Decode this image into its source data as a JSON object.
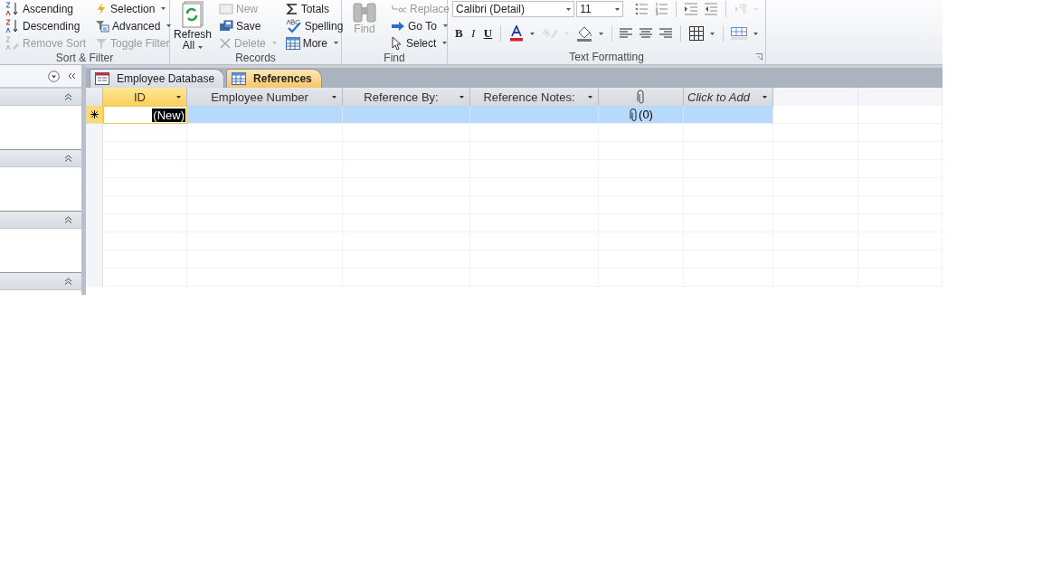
{
  "ribbon": {
    "groups": [
      {
        "label": "Sort & Filter",
        "columns": [
          [
            {
              "kind": "small",
              "label": "Ascending",
              "dropdown": false,
              "disabled": false
            },
            {
              "kind": "small",
              "label": "Descending",
              "dropdown": false,
              "disabled": false
            },
            {
              "kind": "small",
              "label": "Remove Sort",
              "dropdown": false,
              "disabled": true
            }
          ],
          [
            {
              "kind": "small",
              "label": "Selection",
              "dropdown": true,
              "disabled": false
            },
            {
              "kind": "small",
              "label": "Advanced",
              "dropdown": true,
              "disabled": false
            },
            {
              "kind": "small",
              "label": "Toggle Filter",
              "dropdown": false,
              "disabled": true
            }
          ]
        ]
      },
      {
        "label": "Records",
        "columns": [
          [
            {
              "kind": "large",
              "label": "Refresh All",
              "dropdown": true,
              "disabled": false
            }
          ],
          [
            {
              "kind": "small",
              "label": "New",
              "dropdown": false,
              "disabled": true
            },
            {
              "kind": "small",
              "label": "Save",
              "dropdown": false,
              "disabled": false
            },
            {
              "kind": "small",
              "label": "Delete",
              "dropdown": true,
              "disabled": true
            }
          ],
          [
            {
              "kind": "small",
              "label": "Totals",
              "dropdown": false,
              "disabled": false
            },
            {
              "kind": "small",
              "label": "Spelling",
              "dropdown": false,
              "disabled": false
            },
            {
              "kind": "small",
              "label": "More",
              "dropdown": true,
              "disabled": false
            }
          ]
        ]
      },
      {
        "label": "Find",
        "columns": [
          [
            {
              "kind": "large",
              "label": "Find",
              "dropdown": false,
              "disabled": true
            }
          ],
          [
            {
              "kind": "small",
              "label": "Replace",
              "dropdown": false,
              "disabled": true
            },
            {
              "kind": "small",
              "label": "Go To",
              "dropdown": true,
              "disabled": false
            },
            {
              "kind": "small",
              "label": "Select",
              "dropdown": true,
              "disabled": false
            }
          ]
        ]
      },
      {
        "label": "Text Formatting",
        "font": "Calibri (Detail)",
        "size": "11",
        "top_tools": [
          {
            "kind": "icon",
            "dropdown": false,
            "disabled": false
          },
          {
            "kind": "icon",
            "dropdown": false,
            "disabled": false
          },
          {
            "kind": "icon",
            "dropdown": false,
            "disabled": false
          },
          {
            "kind": "icon",
            "dropdown": false,
            "disabled": false
          },
          {
            "kind": "icon",
            "dropdown": true,
            "disabled": true
          }
        ],
        "bottom_tools": [
          {
            "kind": "letter",
            "label": "B"
          },
          {
            "kind": "letter",
            "label": "I"
          },
          {
            "kind": "letter",
            "label": "U"
          },
          {
            "kind": "icon",
            "dropdown": true,
            "disabled": false
          },
          {
            "kind": "icon",
            "dropdown": true,
            "disabled": true
          },
          {
            "kind": "icon",
            "dropdown": true,
            "disabled": false
          },
          {
            "kind": "icon",
            "dropdown": false,
            "disabled": false
          },
          {
            "kind": "icon",
            "dropdown": false,
            "disabled": false
          },
          {
            "kind": "icon",
            "dropdown": false,
            "disabled": false
          },
          {
            "kind": "icon",
            "dropdown": true,
            "disabled": false
          },
          {
            "kind": "icon",
            "dropdown": true,
            "disabled": false
          }
        ]
      }
    ]
  },
  "nav_pane": {
    "sections": [
      {
        "expanded": true
      },
      {
        "expanded": true
      },
      {
        "expanded": true
      },
      {
        "expanded": true
      }
    ]
  },
  "tabs": [
    {
      "label": "Employee Database",
      "kind": "form",
      "selected": false
    },
    {
      "label": "References",
      "kind": "table",
      "selected": true
    }
  ],
  "table": {
    "columns": [
      {
        "kind": "field",
        "label": "ID",
        "selected": true
      },
      {
        "kind": "field",
        "label": "Employee Number",
        "selected": false
      },
      {
        "kind": "field",
        "label": "Reference By:",
        "selected": false
      },
      {
        "kind": "field",
        "label": "Reference Notes:",
        "selected": false
      },
      {
        "kind": "attachment",
        "selected": false
      },
      {
        "kind": "add",
        "label": "Click to Add",
        "selected": false
      }
    ],
    "rows": [
      {
        "new_record": true,
        "selected": true,
        "cells": [
          "(New)",
          null,
          null,
          null,
          "(0)",
          null
        ]
      }
    ]
  }
}
